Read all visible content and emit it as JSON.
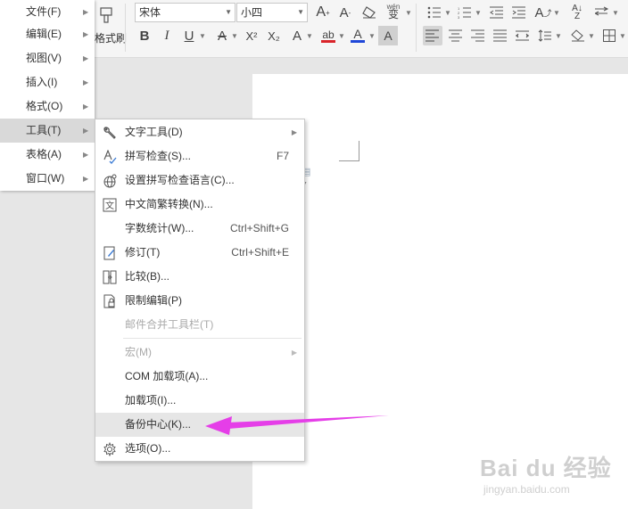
{
  "toolbar": {
    "font_name": "宋体",
    "font_size": "小四",
    "bold": "B",
    "italic": "I",
    "underline": "U",
    "font_color_a": "A",
    "superscript": "X²",
    "subscript": "X₂",
    "highlight_ab": "ab",
    "text_a": "A",
    "shade_a": "A",
    "brush_label": "格式刷",
    "phonetic": "wén"
  },
  "main_menu": [
    {
      "label": "文件(F)"
    },
    {
      "label": "编辑(E)"
    },
    {
      "label": "视图(V)"
    },
    {
      "label": "插入(I)"
    },
    {
      "label": "格式(O)"
    },
    {
      "label": "工具(T)"
    },
    {
      "label": "表格(A)"
    },
    {
      "label": "窗口(W)"
    }
  ],
  "tools_menu": [
    {
      "label": "文字工具(D)",
      "icon": "wrench-icon"
    },
    {
      "label": "拼写检查(S)...",
      "shortcut": "F7",
      "icon": "spell-check-icon"
    },
    {
      "label": "设置拼写检查语言(C)...",
      "icon": "globe-icon"
    },
    {
      "label": "中文简繁转换(N)...",
      "icon": "convert-icon"
    },
    {
      "label": "字数统计(W)...",
      "shortcut": "Ctrl+Shift+G"
    },
    {
      "label": "修订(T)",
      "shortcut": "Ctrl+Shift+E",
      "icon": "revision-icon"
    },
    {
      "label": "比较(B)...",
      "icon": "compare-icon"
    },
    {
      "label": "限制编辑(P)",
      "icon": "lock-doc-icon"
    },
    {
      "label": "邮件合并工具栏(T)"
    },
    {
      "label": "宏(M)"
    },
    {
      "label": "COM 加载项(A)..."
    },
    {
      "label": "加载项(I)..."
    },
    {
      "label": "备份中心(K)..."
    },
    {
      "label": "选项(O)...",
      "icon": "gear-icon"
    }
  ],
  "watermark": {
    "brand": "Bai du 经验",
    "url": "jingyan.baidu.com"
  },
  "colors": {
    "arrow": "#e53ee8",
    "underline_red": "#d9242a",
    "font_blue": "#1f47d8"
  }
}
